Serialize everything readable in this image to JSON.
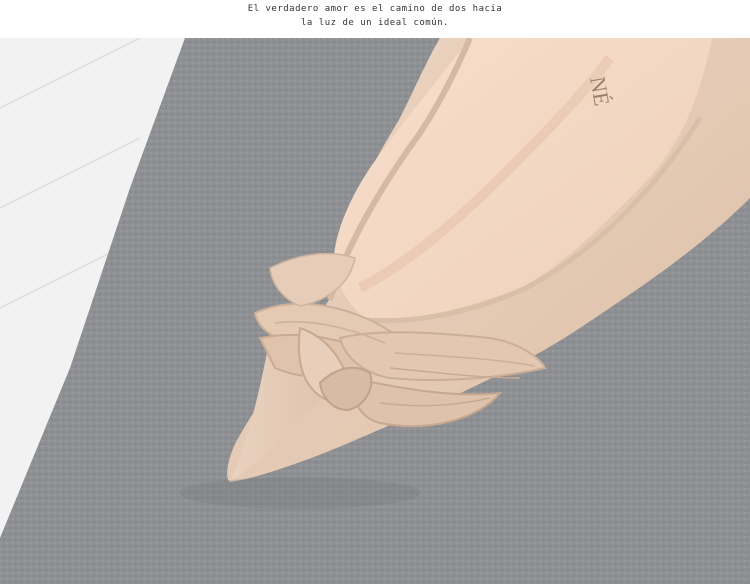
{
  "caption": {
    "line1": "El verdadero amor es el camino de dos hacia",
    "line2": "la luz de un ideal común."
  },
  "photo": {
    "subject": "photo-shoe-closeup",
    "brand_mark": "NÉ"
  },
  "colors": {
    "rug": "#8f9195",
    "floor": "#f3f3f3",
    "suede": "#e6cdb8",
    "lining": "#f2d6c2"
  }
}
